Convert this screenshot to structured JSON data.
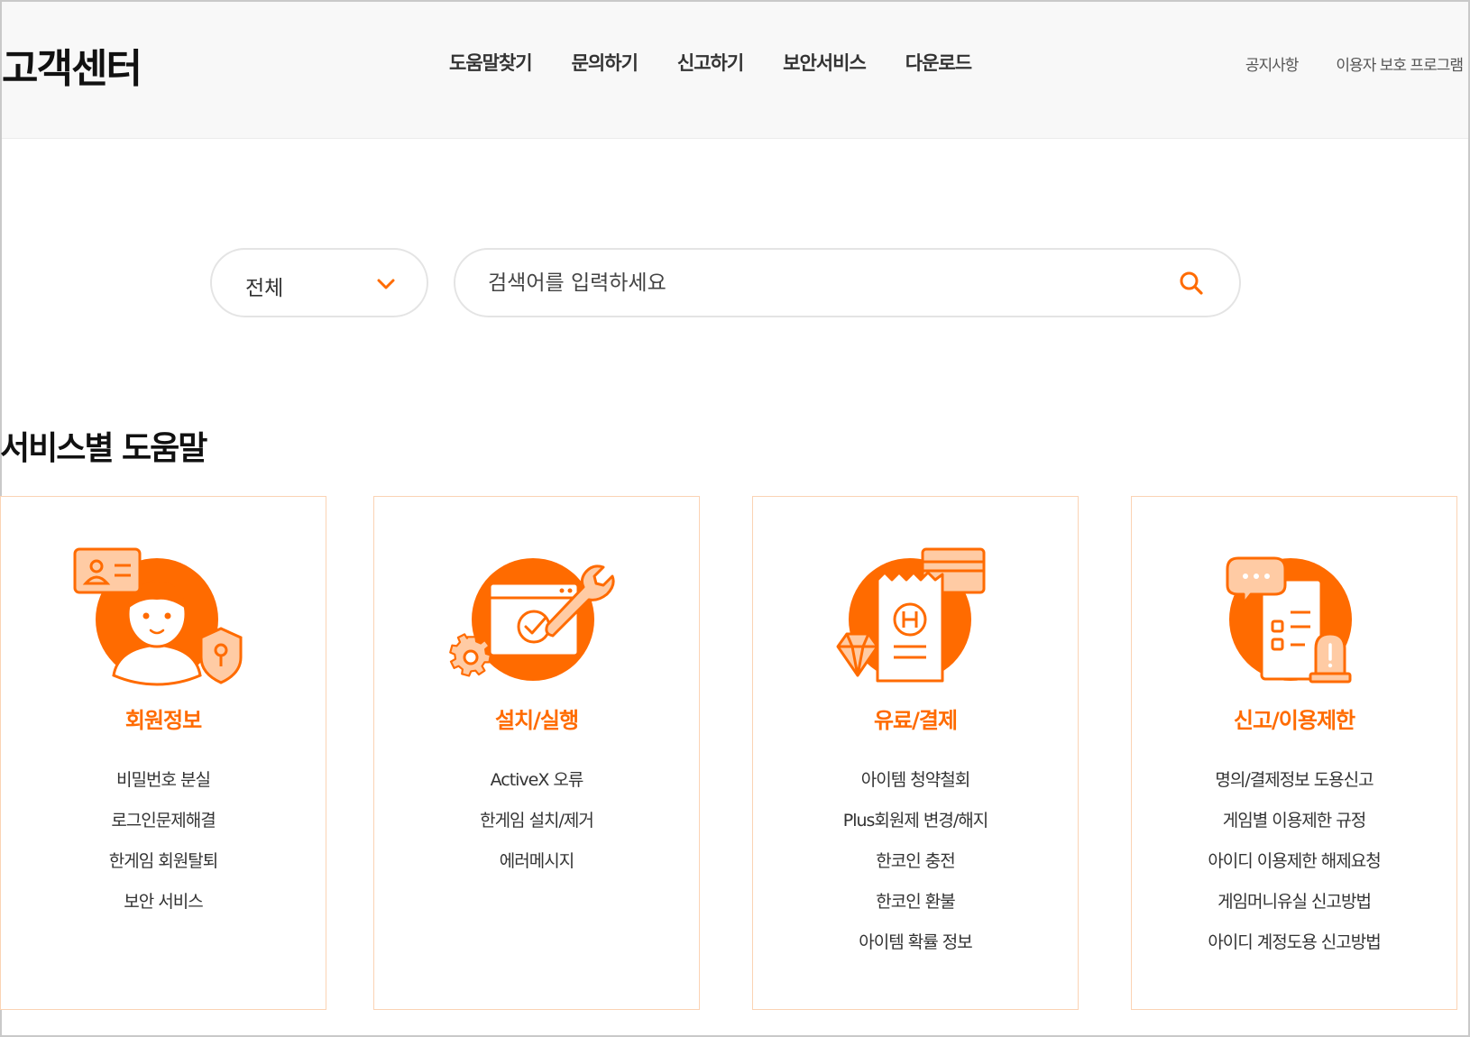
{
  "header": {
    "logo": "고객센터",
    "nav": [
      "도움말찾기",
      "문의하기",
      "신고하기",
      "보안서비스",
      "다운로드"
    ],
    "util": [
      "공지사항",
      "이용자 보호 프로그램"
    ]
  },
  "search": {
    "category_selected": "전체",
    "placeholder": "검색어를 입력하세요",
    "value": ""
  },
  "section": {
    "title": "서비스별 도움말"
  },
  "cards": [
    {
      "icon": "member-info-icon",
      "title": "회원정보",
      "links": [
        "비밀번호 분실",
        "로그인문제해결",
        "한게임 회원탈퇴",
        "보안 서비스"
      ]
    },
    {
      "icon": "install-run-icon",
      "title": "설치/실행",
      "links": [
        "ActiveX 오류",
        "한게임 설치/제거",
        "에러메시지"
      ]
    },
    {
      "icon": "payment-icon",
      "title": "유료/결제",
      "links": [
        "아이템 청약철회",
        "Plus회원제 변경/해지",
        "한코인 충전",
        "한코인 환불",
        "아이템 확률 정보"
      ]
    },
    {
      "icon": "report-restriction-icon",
      "title": "신고/이용제한",
      "links": [
        "명의/결제정보 도용신고",
        "게임별 이용제한 규정",
        "아이디 이용제한 해제요청",
        "게임머니유실 신고방법",
        "아이디 계정도용 신고방법"
      ]
    }
  ],
  "colors": {
    "accent": "#ff6b00",
    "accent_light": "#ffcba4",
    "card_border": "#fbd3b4",
    "header_bg": "#f8f8f8"
  }
}
